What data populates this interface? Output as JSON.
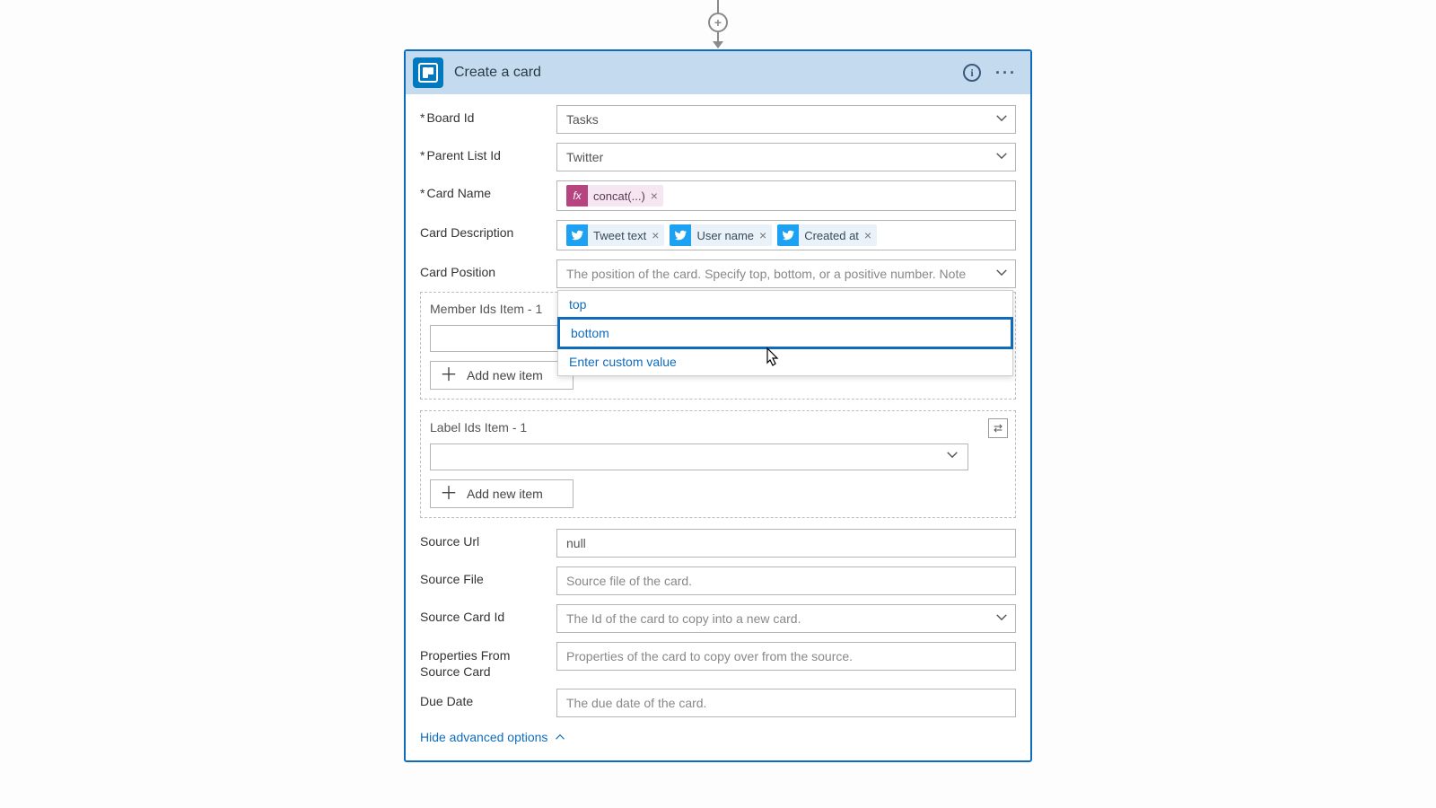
{
  "header": {
    "title": "Create a card"
  },
  "fields": {
    "boardId": {
      "label": "Board Id",
      "value": "Tasks",
      "required": true
    },
    "parentList": {
      "label": "Parent List Id",
      "value": "Twitter",
      "required": true
    },
    "cardName": {
      "label": "Card Name",
      "required": true,
      "token": {
        "type": "fx",
        "label": "concat(...)"
      }
    },
    "cardDesc": {
      "label": "Card Description",
      "tokens": [
        {
          "type": "tw",
          "label": "Tweet text"
        },
        {
          "type": "tw",
          "label": "User name"
        },
        {
          "type": "tw",
          "label": "Created at"
        }
      ]
    },
    "cardPos": {
      "label": "Card Position",
      "placeholder": "The position of the card. Specify top, bottom, or a positive number. Note",
      "options": [
        "top",
        "bottom",
        "Enter custom value"
      ],
      "hoveredIndex": 1
    },
    "memberIds": {
      "label": "Member Ids Item - 1",
      "addLabel": "Add new item"
    },
    "labelIds": {
      "label": "Label Ids Item - 1",
      "addLabel": "Add new item"
    },
    "sourceUrl": {
      "label": "Source Url",
      "value": "null"
    },
    "sourceFile": {
      "label": "Source File",
      "placeholder": "Source file of the card."
    },
    "sourceCardId": {
      "label": "Source Card Id",
      "placeholder": "The Id of the card to copy into a new card."
    },
    "propsFromSrc": {
      "label": "Properties From Source Card",
      "placeholder": "Properties of the card to copy over from the source."
    },
    "dueDate": {
      "label": "Due Date",
      "placeholder": "The due date of the card."
    }
  },
  "footer": {
    "hideAdvanced": "Hide advanced options"
  }
}
